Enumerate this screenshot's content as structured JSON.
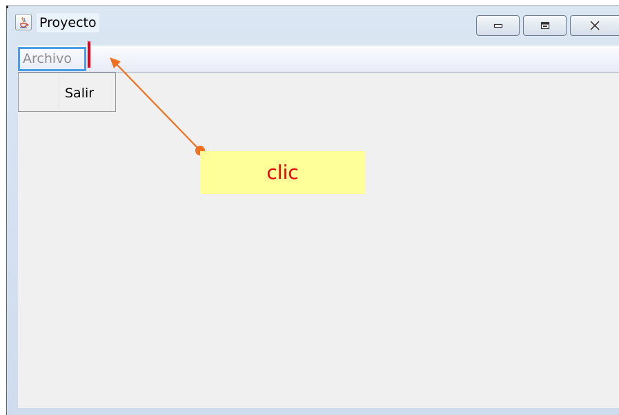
{
  "window": {
    "title": "Proyecto",
    "app_icon": "java-cup-icon",
    "controls": {
      "minimize": "minimize-icon",
      "maximize": "maximize-icon",
      "close": "close-icon"
    }
  },
  "menubar": {
    "menus": [
      {
        "label": "Archivo",
        "state": "active"
      }
    ]
  },
  "dropdown": {
    "items": [
      {
        "label": "Salir"
      }
    ]
  },
  "annotation": {
    "callout_text": "clic",
    "callout_background": "#ffff99",
    "callout_text_color": "#e60000",
    "arrow_color": "#f07020",
    "caret_color": "#e8001a"
  }
}
